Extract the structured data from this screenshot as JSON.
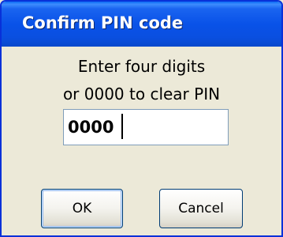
{
  "dialog": {
    "title": "Confirm PIN code",
    "message_line1": "Enter four digits",
    "message_line2": "or 0000 to clear PIN",
    "pin_value": "0000",
    "ok_label": "OK",
    "cancel_label": "Cancel"
  },
  "colors": {
    "titlebar": "#0A52E8",
    "title_text": "#FFFFFF",
    "dialog_bg": "#ECE9D8",
    "input_border": "#7F9DB9",
    "button_border": "#003C74"
  }
}
